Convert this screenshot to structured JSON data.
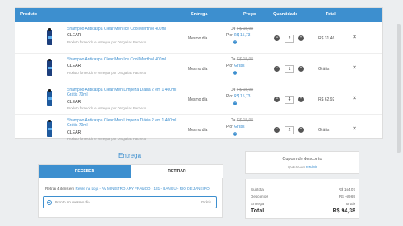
{
  "header": {
    "produto": "Produto",
    "entrega": "Entrega",
    "preco": "Preço",
    "quantidade": "Quantidade",
    "total": "Total"
  },
  "items": [
    {
      "name": "Shampoo Anticaspa Clear Men Ice Cool Menthol 400ml",
      "brand": "CLEAR",
      "seller": "Produto fornecido e entregue por Drogarias Pacheco",
      "delivery": "Mesmo dia",
      "old_price_prefix": "De",
      "old_price": "R$ 15,93",
      "new_price_prefix": "Por",
      "new_price": "R$ 15,73",
      "quantity": "2",
      "total": "R$ 31,46",
      "color": "#1d3f7d"
    },
    {
      "name": "Shampoo Anticaspa Clear Men Ice Cool Menthol 400ml",
      "brand": "CLEAR",
      "seller": "Produto fornecido e entregue por Drogarias Pacheco",
      "delivery": "Mesmo dia",
      "old_price_prefix": "De",
      "old_price": "R$ 15,93",
      "new_price_prefix": "Por",
      "new_price": "Grátis",
      "quantity": "1",
      "total": "Grátis",
      "color": "#1d3f7d"
    },
    {
      "name": "Shampoo Anticaspa Clear Men Limpeza Diária 2 em 1 400ml Grátis 70ml",
      "brand": "CLEAR",
      "seller": "Produto fornecido e entregue por Drogarias Pacheco",
      "delivery": "Mesmo dia",
      "old_price_prefix": "De",
      "old_price": "R$ 15,93",
      "new_price_prefix": "Por",
      "new_price": "R$ 15,73",
      "quantity": "4",
      "total": "R$ 62,92",
      "color": "#1f5a9e"
    },
    {
      "name": "Shampoo Anticaspa Clear Men Limpeza Diária 2 em 1 400ml Grátis 70ml",
      "brand": "CLEAR",
      "seller": "Produto fornecido e entregue por Drogarias Pacheco",
      "delivery": "Mesmo dia",
      "old_price_prefix": "De",
      "old_price": "R$ 15,93",
      "new_price_prefix": "Por",
      "new_price": "Grátis",
      "quantity": "2",
      "total": "Grátis",
      "color": "#1f5a9e"
    }
  ],
  "delivery": {
    "title": "Entrega",
    "tab_receive": "RECEBER",
    "tab_pickup": "RETIRAR",
    "address_prefix": "Retirar 4 itens em",
    "address_link": "Retire na Loja - AV MINISTRO ARY FRANCO - 131 - BANGU - RIO DE JANEIRO",
    "option_label": "Pronto no mesmo dia",
    "option_value": "Grátis"
  },
  "coupon": {
    "title": "Cupom de desconto",
    "code": "QUERO15",
    "remove": "excluir"
  },
  "summary": {
    "subtotal_label": "Subtotal",
    "subtotal": "R$ 164,07",
    "discounts_label": "Descontos",
    "discounts": "R$ -69,69",
    "delivery_label": "Entrega",
    "delivery": "Grátis",
    "total_label": "Total",
    "total": "R$ 94,38"
  },
  "colors": {
    "accent": "#3d8fcf",
    "background": "#eceef0"
  }
}
